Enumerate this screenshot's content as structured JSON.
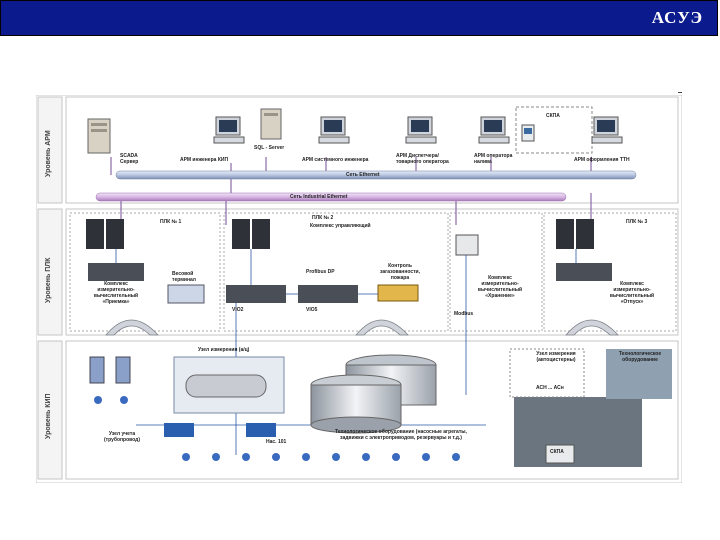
{
  "header": {
    "title": "АСУЭ"
  },
  "levels": {
    "arm": "Уровень АРМ",
    "plc": "Уровень ПЛК",
    "kip": "Уровень КИП"
  },
  "arm": {
    "scada_server": "SCADA\nСервер",
    "sql_server": "SQL - Server",
    "arm_kip": "АРМ инженера КИП",
    "arm_sys": "АРМ системного инженера",
    "arm_dispatch": "АРМ Диспетчера/\nтоварного оператора",
    "arm_operator": "АРМ оператора\nналива",
    "skpa": "СКПА",
    "arm_ttn": "АРМ оформления ТТН",
    "net_ethernet": "Сеть Ethernet",
    "net_industrial": "Сеть Industrial Ethernet"
  },
  "plc": {
    "plc1": "ПЛК № 1",
    "plc2": "ПЛК № 2",
    "plc2_sub": "Комплекс управляющий",
    "plc3": "ПЛК № 3",
    "complex1": "Комплекс\nизмерительно-\nвычислительный\n«Приемка»",
    "complex2": "Комплекс\nизмерительно-\nвычислительный\n«Хранение»",
    "complex3": "Комплекс\nизмерительно-\nвычислительный\n«Отпуск»",
    "terminal": "Весовой\nтерминал",
    "profibus": "Profibus DP",
    "leak_control": "Контроль\nзагазованности,\nпожара",
    "vio1": "VIO2",
    "vio2": "VIO5",
    "modbus": "Modbus"
  },
  "kip": {
    "meter_auto": "Узел измерения (а/ц)",
    "meter_tube": "Узел учета\n(трубопровод)",
    "pump": "Нас. 101",
    "tanks": "Технологическое оборудование (насосные агрегаты,\nзадвижки с электроприводом, резервуары и т.д.)",
    "meter_auto2": "Узел измерения\n(автоцистерны)",
    "tech_equip": "Технологическое\nоборудование",
    "asn": "АСН ... АСн",
    "skpa2": "СКПА"
  }
}
